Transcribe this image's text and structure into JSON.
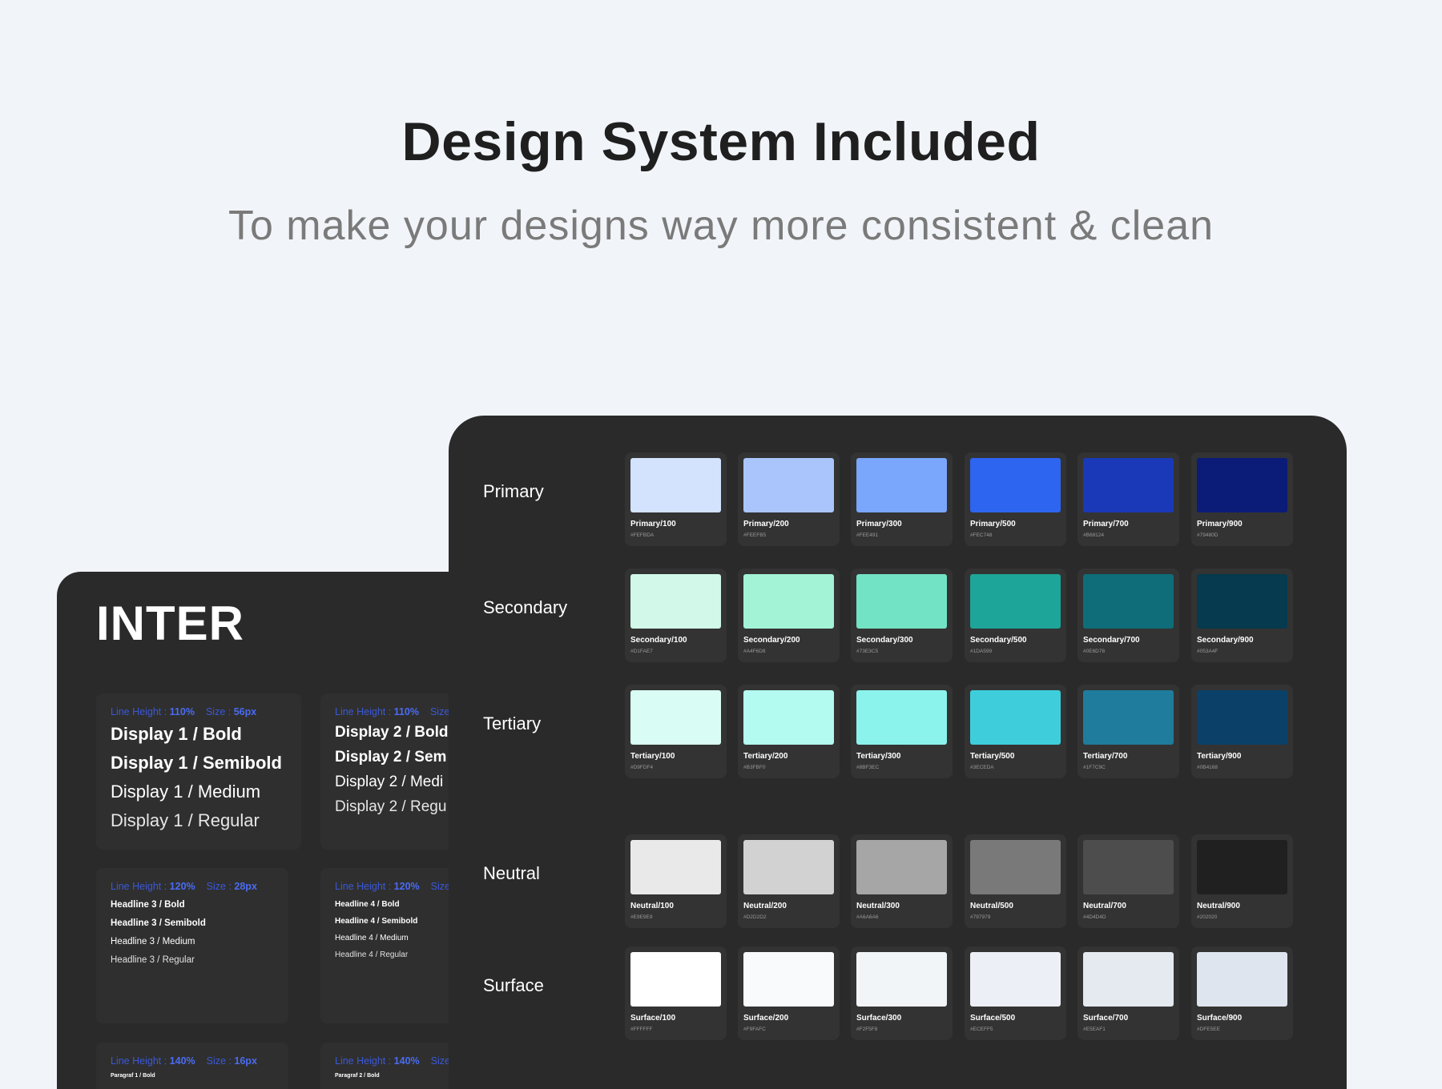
{
  "header": {
    "title": "Design System Included",
    "subtitle": "To make your designs way more consistent & clean"
  },
  "typography": {
    "font_name": "INTER",
    "groups": [
      {
        "line_height_label": "Line Height : ",
        "line_height": "110%",
        "size_label": "Size : ",
        "size": "56px",
        "styles": [
          "Display 1 / Bold",
          "Display 1 / Semibold",
          "Display 1 / Medium",
          "Display 1 / Regular"
        ]
      },
      {
        "line_height_label": "Line Height : ",
        "line_height": "110%",
        "size_label": "Size : ",
        "size": "",
        "styles": [
          "Display 2 / Bold",
          "Display 2 / Sem",
          "Display 2 / Medi",
          "Display 2 / Regu"
        ]
      },
      {
        "line_height_label": "Line Height : ",
        "line_height": "120%",
        "size_label": "Size : ",
        "size": "28px",
        "styles": [
          "Headline 3 / Bold",
          "Headline 3 / Semibold",
          "Headline 3 / Medium",
          "Headline 3 / Regular"
        ]
      },
      {
        "line_height_label": "Line Height : ",
        "line_height": "120%",
        "size_label": "Size",
        "size": "",
        "styles": [
          "Headline 4 / Bold",
          "Headline 4 / Semibold",
          "Headline 4 / Medium",
          "Headline 4 / Regular"
        ]
      },
      {
        "line_height_label": "Line Height : ",
        "line_height": "140%",
        "size_label": "Size : ",
        "size": "16px",
        "styles": [
          "Paragraf 1 / Bold"
        ]
      },
      {
        "line_height_label": "Line Height : ",
        "line_height": "140%",
        "size_label": "Size",
        "size": "",
        "styles": [
          "Paragraf 2 / Bold"
        ]
      }
    ]
  },
  "palette": [
    {
      "label": "Primary",
      "swatches": [
        {
          "name": "Primary/100",
          "hex": "#FEFBDA",
          "color": "#d3e2fd"
        },
        {
          "name": "Primary/200",
          "hex": "#FEEFB5",
          "color": "#a9c5fc"
        },
        {
          "name": "Primary/300",
          "hex": "#FEE491",
          "color": "#7aa6fb"
        },
        {
          "name": "Primary/500",
          "hex": "#FEC748",
          "color": "#2d64f0"
        },
        {
          "name": "Primary/700",
          "hex": "#B68124",
          "color": "#1a39b8"
        },
        {
          "name": "Primary/900",
          "hex": "#79480D",
          "color": "#0b1b78"
        }
      ]
    },
    {
      "label": "Secondary",
      "swatches": [
        {
          "name": "Secondary/100",
          "hex": "#D1FAE7",
          "color": "#d1f8e8"
        },
        {
          "name": "Secondary/200",
          "hex": "#A4F6D8",
          "color": "#a3f3d6"
        },
        {
          "name": "Secondary/300",
          "hex": "#73E3C5",
          "color": "#73e3c5"
        },
        {
          "name": "Secondary/500",
          "hex": "#1DA599",
          "color": "#1da599"
        },
        {
          "name": "Secondary/700",
          "hex": "#0E6D78",
          "color": "#0e6d78"
        },
        {
          "name": "Secondary/900",
          "hex": "#053A4F",
          "color": "#053a4f"
        }
      ]
    },
    {
      "label": "Tertiary",
      "swatches": [
        {
          "name": "Tertiary/100",
          "hex": "#D9FDF4",
          "color": "#d9fdf4"
        },
        {
          "name": "Tertiary/200",
          "hex": "#B3FBF0",
          "color": "#b3fbf0"
        },
        {
          "name": "Tertiary/300",
          "hex": "#8BF3EC",
          "color": "#8bf3ec"
        },
        {
          "name": "Tertiary/500",
          "hex": "#3ECEDA",
          "color": "#3ecedb"
        },
        {
          "name": "Tertiary/700",
          "hex": "#1F7C9C",
          "color": "#1f7c9c"
        },
        {
          "name": "Tertiary/900",
          "hex": "#0B4168",
          "color": "#0b4168"
        }
      ]
    },
    {
      "label": "Neutral",
      "swatches": [
        {
          "name": "Neutral/100",
          "hex": "#E9E9E9",
          "color": "#e9e9e9"
        },
        {
          "name": "Neutral/200",
          "hex": "#D2D2D2",
          "color": "#d2d2d2"
        },
        {
          "name": "Neutral/300",
          "hex": "#A6A6A6",
          "color": "#a6a6a6"
        },
        {
          "name": "Neutral/500",
          "hex": "#797979",
          "color": "#797979"
        },
        {
          "name": "Neutral/700",
          "hex": "#4D4D4D",
          "color": "#4d4d4d"
        },
        {
          "name": "Neutral/900",
          "hex": "#202020",
          "color": "#202020"
        }
      ]
    },
    {
      "label": "Surface",
      "swatches": [
        {
          "name": "Surface/100",
          "hex": "#FFFFFF",
          "color": "#ffffff"
        },
        {
          "name": "Surface/200",
          "hex": "#F9FAFC",
          "color": "#f9fafc"
        },
        {
          "name": "Surface/300",
          "hex": "#F2F5F8",
          "color": "#f2f5f8"
        },
        {
          "name": "Surface/500",
          "hex": "#ECEFF5",
          "color": "#eceff5"
        },
        {
          "name": "Surface/700",
          "hex": "#E5EAF1",
          "color": "#e5eaf1"
        },
        {
          "name": "Surface/900",
          "hex": "#DFE5EE",
          "color": "#dfe5ee"
        }
      ]
    }
  ]
}
